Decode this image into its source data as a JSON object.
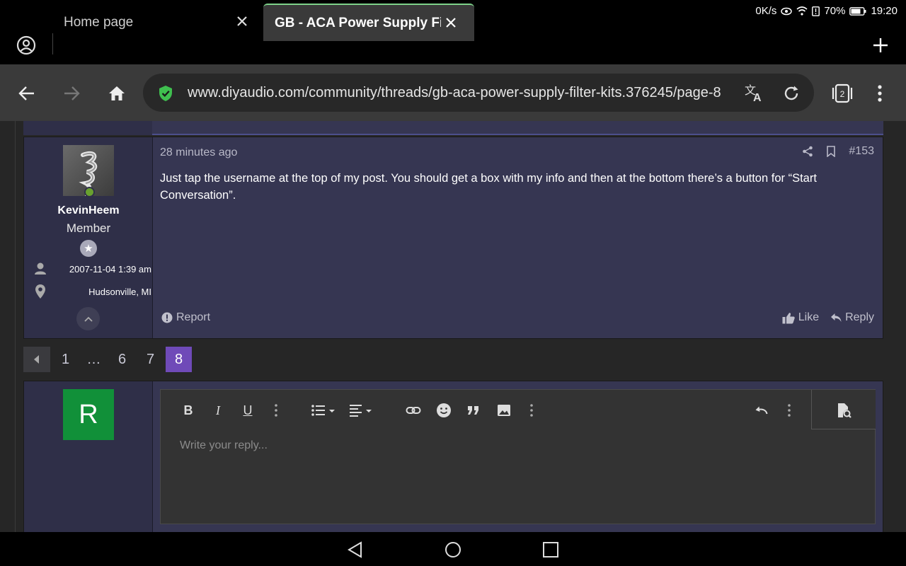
{
  "status_bar": {
    "net_speed": "0K/s",
    "battery": "70%",
    "time": "19:20"
  },
  "tabs": [
    {
      "title": "Home page",
      "active": false
    },
    {
      "title": "GB - ACA Power Supply Filter Kits",
      "active": true
    }
  ],
  "toolbar": {
    "url": "www.diyaudio.com/community/threads/gb-aca-power-supply-filter-kits.376245/page-8",
    "tab_count": "2"
  },
  "post": {
    "username": "KevinHeem",
    "user_title": "Member",
    "joined": "2007-11-04 1:39 am",
    "location": "Hudsonville, MI",
    "time": "28 minutes ago",
    "number": "#153",
    "text": "Just tap the username at the top of my post. You should get a box with my info and then at the bottom there’s a button for “Start Conversation”.",
    "report_label": "Report",
    "like_label": "Like",
    "reply_label": "Reply"
  },
  "pagination": {
    "pages": [
      "1",
      "…",
      "6",
      "7",
      "8"
    ],
    "current": "8"
  },
  "reply_editor": {
    "avatar_letter": "R",
    "placeholder": "Write your reply...",
    "bold": "B",
    "italic": "I",
    "underline": "U"
  },
  "colors": {
    "accent": "#6f4ab8",
    "post_bg": "#363652",
    "user_col_bg": "#2f2f48",
    "online": "#69a12f",
    "reply_avatar": "#119039"
  }
}
